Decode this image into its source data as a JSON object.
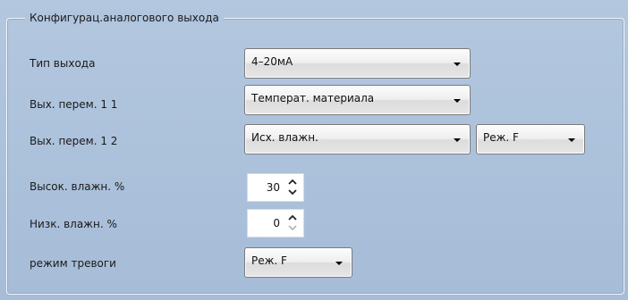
{
  "group": {
    "title": "Конфигурац.аналогового выхода"
  },
  "rows": {
    "output_type": {
      "label": "Тип выхода",
      "value": "4–20мА"
    },
    "output_var_1_1": {
      "label": "Вых. перем. 1 1",
      "value": "Температ. материала"
    },
    "output_var_1_2": {
      "label": "Вых. перем. 1 2",
      "value": "Исх. влажн.",
      "mode_value": "Реж. F"
    },
    "high_moisture": {
      "label": "Высок. влажн. %",
      "value": "30"
    },
    "low_moisture": {
      "label": "Низк. влажн. %",
      "value": "0"
    },
    "alarm_mode": {
      "label": "режим тревоги",
      "value": "Реж. F"
    }
  },
  "icons": {
    "dropdown": "chevron-down-icon",
    "spin_up": "chevron-up-icon",
    "spin_down": "chevron-down-icon"
  },
  "colors": {
    "panel_background": "#a9bfd9",
    "group_border": "#f3f7fb",
    "combo_border": "#7a7a7a"
  }
}
